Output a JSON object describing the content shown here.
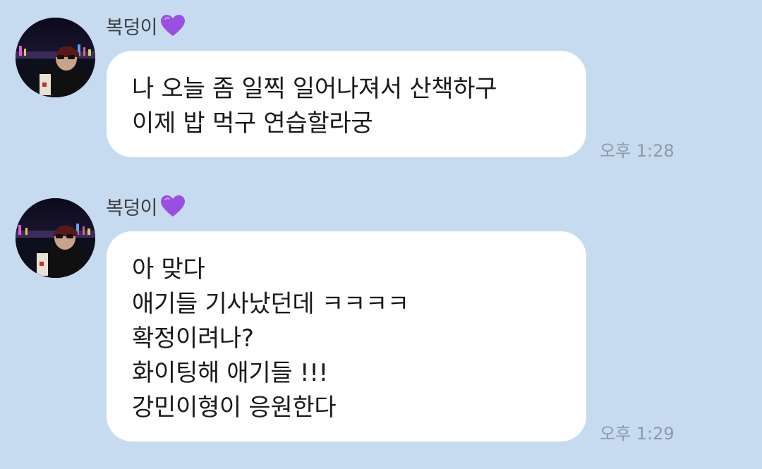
{
  "messages": [
    {
      "sender": "복덩이",
      "lines": [
        "나 오늘 좀 일찍 일어나져서 산책하구",
        "이제 밥 먹구 연습할라궁"
      ],
      "time": "오후 1:28"
    },
    {
      "sender": "복덩이",
      "lines": [
        "아 맞다",
        "애기들 기사났던데 ㅋㅋㅋㅋ",
        "확정이려나?",
        "화이팅해 애기들 !!!",
        "강민이형이 응원한다"
      ],
      "time": "오후 1:29"
    }
  ],
  "icons": {
    "sender_badge": "purple-heart-icon",
    "avatar": "profile-photo-night-skyline"
  },
  "colors": {
    "background": "#c6daf0",
    "bubble": "#ffffff",
    "heart": "#9b4fe0",
    "timestamp": "#8f9aa6"
  }
}
